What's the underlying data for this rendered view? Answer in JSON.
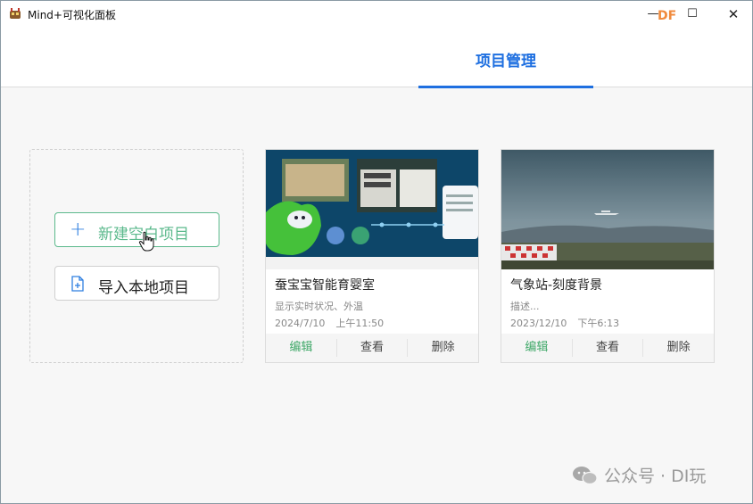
{
  "window": {
    "title": "Mind+可视化面板",
    "badge": "DF",
    "controls": {
      "minimize": "—",
      "maximize": "☐",
      "close": "✕"
    }
  },
  "header": {
    "tabs": [
      {
        "label": "项目管理",
        "active": true
      }
    ],
    "accent_color": "#1e6fe0"
  },
  "create_panel": {
    "new_button": {
      "icon": "plus-icon",
      "label": "新建空白项目"
    },
    "import_button": {
      "icon": "file-plus-icon",
      "label": "导入本地项目"
    }
  },
  "projects": [
    {
      "title": "蚕宝宝智能育婴室",
      "description": "显示实时状况、外温",
      "date": "2024/7/10",
      "time": "上午11:50",
      "actions": {
        "edit": "编辑",
        "view": "查看",
        "delete": "删除"
      }
    },
    {
      "title": "气象站-刻度背景",
      "description": "描述...",
      "date": "2023/12/10",
      "time": "下午6:13",
      "actions": {
        "edit": "编辑",
        "view": "查看",
        "delete": "删除"
      }
    }
  ],
  "watermark": {
    "text": "公众号 · DI玩"
  },
  "colors": {
    "edit_green": "#3fa868",
    "new_button_green": "#5bb98c",
    "badge_orange": "#f08a3c"
  }
}
